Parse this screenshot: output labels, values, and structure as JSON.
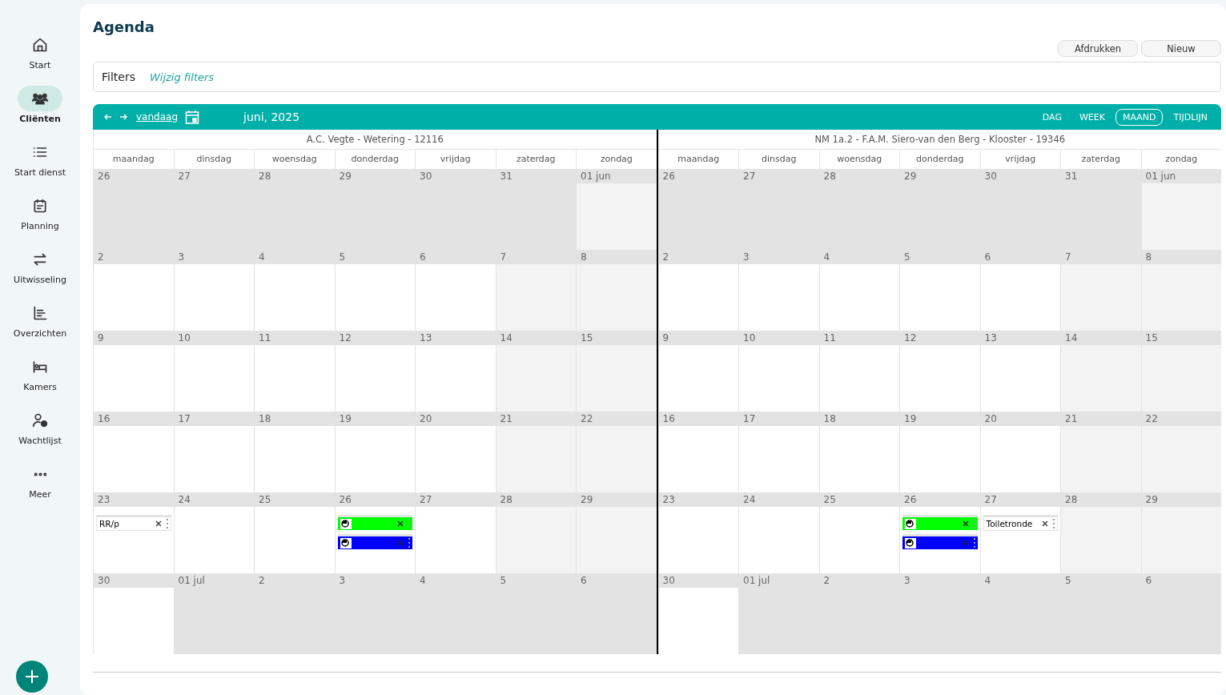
{
  "sidebar": {
    "items": [
      {
        "label": "Start",
        "selected": false
      },
      {
        "label": "Cliënten",
        "selected": true
      },
      {
        "label": "Start dienst",
        "selected": false
      },
      {
        "label": "Planning",
        "selected": false
      },
      {
        "label": "Uitwisseling",
        "selected": false
      },
      {
        "label": "Overzichten",
        "selected": false
      },
      {
        "label": "Kamers",
        "selected": false
      },
      {
        "label": "Wachtlijst",
        "selected": false
      },
      {
        "label": "Meer",
        "selected": false
      }
    ]
  },
  "page": {
    "title": "Agenda",
    "buttons": [
      "Afdrukken",
      "Nieuw"
    ]
  },
  "filters": {
    "label": "Filters",
    "link": "Wijzig filters"
  },
  "toolbar": {
    "today": "vandaag",
    "period": "juni, 2025",
    "views": [
      {
        "label": "DAG",
        "selected": false
      },
      {
        "label": "WEEK",
        "selected": false
      },
      {
        "label": "MAAND",
        "selected": true
      },
      {
        "label": "TIJDLIJN",
        "selected": false
      }
    ]
  },
  "resources": [
    {
      "title": "A.C. Vegte - Wetering - 12116",
      "weekdays": [
        "maandag",
        "dinsdag",
        "woensdag",
        "donderdag",
        "vrijdag",
        "zaterdag",
        "zondag"
      ],
      "weeks": [
        [
          {
            "day": "26",
            "in_month": false
          },
          {
            "day": "27",
            "in_month": false
          },
          {
            "day": "28",
            "in_month": false
          },
          {
            "day": "29",
            "in_month": false
          },
          {
            "day": "30",
            "in_month": false
          },
          {
            "day": "31",
            "in_month": false
          },
          {
            "day": "01 jun",
            "in_month": true
          }
        ],
        [
          {
            "day": "2",
            "in_month": true
          },
          {
            "day": "3",
            "in_month": true
          },
          {
            "day": "4",
            "in_month": true
          },
          {
            "day": "5",
            "in_month": true
          },
          {
            "day": "6",
            "in_month": true
          },
          {
            "day": "7",
            "in_month": true
          },
          {
            "day": "8",
            "in_month": true
          }
        ],
        [
          {
            "day": "9",
            "in_month": true
          },
          {
            "day": "10",
            "in_month": true
          },
          {
            "day": "11",
            "in_month": true
          },
          {
            "day": "12",
            "in_month": true
          },
          {
            "day": "13",
            "in_month": true
          },
          {
            "day": "14",
            "in_month": true
          },
          {
            "day": "15",
            "in_month": true
          }
        ],
        [
          {
            "day": "16",
            "in_month": true
          },
          {
            "day": "17",
            "in_month": true
          },
          {
            "day": "18",
            "in_month": true
          },
          {
            "day": "19",
            "in_month": true
          },
          {
            "day": "20",
            "in_month": true
          },
          {
            "day": "21",
            "in_month": true
          },
          {
            "day": "22",
            "in_month": true
          }
        ],
        [
          {
            "day": "23",
            "in_month": true,
            "events": [
              {
                "kind": "text",
                "label": "RR/p"
              }
            ]
          },
          {
            "day": "24",
            "in_month": true
          },
          {
            "day": "25",
            "in_month": true
          },
          {
            "day": "26",
            "in_month": true,
            "events": [
              {
                "kind": "icon",
                "color": "#00ff00"
              },
              {
                "kind": "icon",
                "color": "#0000ff"
              }
            ]
          },
          {
            "day": "27",
            "in_month": true
          },
          {
            "day": "28",
            "in_month": true
          },
          {
            "day": "29",
            "in_month": true
          }
        ],
        [
          {
            "day": "30",
            "in_month": true
          },
          {
            "day": "01 jul",
            "in_month": false
          },
          {
            "day": "2",
            "in_month": false
          },
          {
            "day": "3",
            "in_month": false
          },
          {
            "day": "4",
            "in_month": false
          },
          {
            "day": "5",
            "in_month": false
          },
          {
            "day": "6",
            "in_month": false
          }
        ]
      ]
    },
    {
      "title": "NM 1a.2 - F.A.M. Siero-van den Berg - Klooster - 19346",
      "weekdays": [
        "maandag",
        "dinsdag",
        "woensdag",
        "donderdag",
        "vrijdag",
        "zaterdag",
        "zondag"
      ],
      "weeks": [
        [
          {
            "day": "26",
            "in_month": false
          },
          {
            "day": "27",
            "in_month": false
          },
          {
            "day": "28",
            "in_month": false
          },
          {
            "day": "29",
            "in_month": false
          },
          {
            "day": "30",
            "in_month": false
          },
          {
            "day": "31",
            "in_month": false
          },
          {
            "day": "01 jun",
            "in_month": true
          }
        ],
        [
          {
            "day": "2",
            "in_month": true
          },
          {
            "day": "3",
            "in_month": true
          },
          {
            "day": "4",
            "in_month": true
          },
          {
            "day": "5",
            "in_month": true
          },
          {
            "day": "6",
            "in_month": true
          },
          {
            "day": "7",
            "in_month": true
          },
          {
            "day": "8",
            "in_month": true
          }
        ],
        [
          {
            "day": "9",
            "in_month": true
          },
          {
            "day": "10",
            "in_month": true
          },
          {
            "day": "11",
            "in_month": true
          },
          {
            "day": "12",
            "in_month": true
          },
          {
            "day": "13",
            "in_month": true
          },
          {
            "day": "14",
            "in_month": true
          },
          {
            "day": "15",
            "in_month": true
          }
        ],
        [
          {
            "day": "16",
            "in_month": true
          },
          {
            "day": "17",
            "in_month": true
          },
          {
            "day": "18",
            "in_month": true
          },
          {
            "day": "19",
            "in_month": true
          },
          {
            "day": "20",
            "in_month": true
          },
          {
            "day": "21",
            "in_month": true
          },
          {
            "day": "22",
            "in_month": true
          }
        ],
        [
          {
            "day": "23",
            "in_month": true
          },
          {
            "day": "24",
            "in_month": true
          },
          {
            "day": "25",
            "in_month": true
          },
          {
            "day": "26",
            "in_month": true,
            "events": [
              {
                "kind": "icon",
                "color": "#00ff00"
              },
              {
                "kind": "icon",
                "color": "#0000ff"
              }
            ]
          },
          {
            "day": "27",
            "in_month": true,
            "events": [
              {
                "kind": "text",
                "label": "Toiletronde"
              }
            ]
          },
          {
            "day": "28",
            "in_month": true
          },
          {
            "day": "29",
            "in_month": true
          }
        ],
        [
          {
            "day": "30",
            "in_month": true
          },
          {
            "day": "01 jul",
            "in_month": false
          },
          {
            "day": "2",
            "in_month": false
          },
          {
            "day": "3",
            "in_month": false
          },
          {
            "day": "4",
            "in_month": false
          },
          {
            "day": "5",
            "in_month": false
          },
          {
            "day": "6",
            "in_month": false
          }
        ]
      ]
    }
  ]
}
